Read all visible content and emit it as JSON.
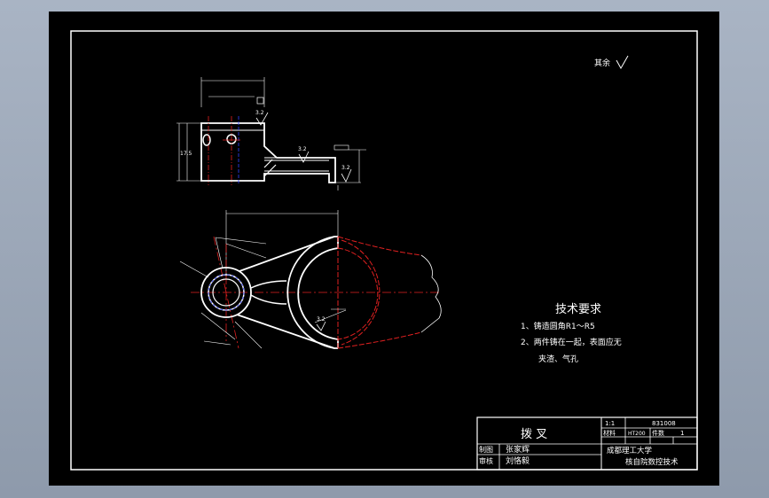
{
  "surface_roughness_note": "其余",
  "tech_requirements": {
    "title": "技术要求",
    "item1": "1、铸造圆角R1～R5",
    "item2": "2、两件铸在一起，表面应无",
    "item2_cont": "夹渣、气孔"
  },
  "title_block": {
    "part_name": "拨 叉",
    "scale": "1:1",
    "drawing_no": "831008",
    "material_label": "材料",
    "material": "HT200",
    "quantity_label": "件数",
    "quantity": "1",
    "drawn_label": "制图",
    "drawn_by": "张家辉",
    "checked_label": "审核",
    "checked_by": "刘恪毅",
    "school": "成都理工大学",
    "department": "核自院数控技术"
  },
  "dimensions": {
    "d_175": "17.5",
    "d_32a": "3.2",
    "d_32b": "3.2",
    "d_32c": "3.2",
    "d_32d": "3.2"
  }
}
